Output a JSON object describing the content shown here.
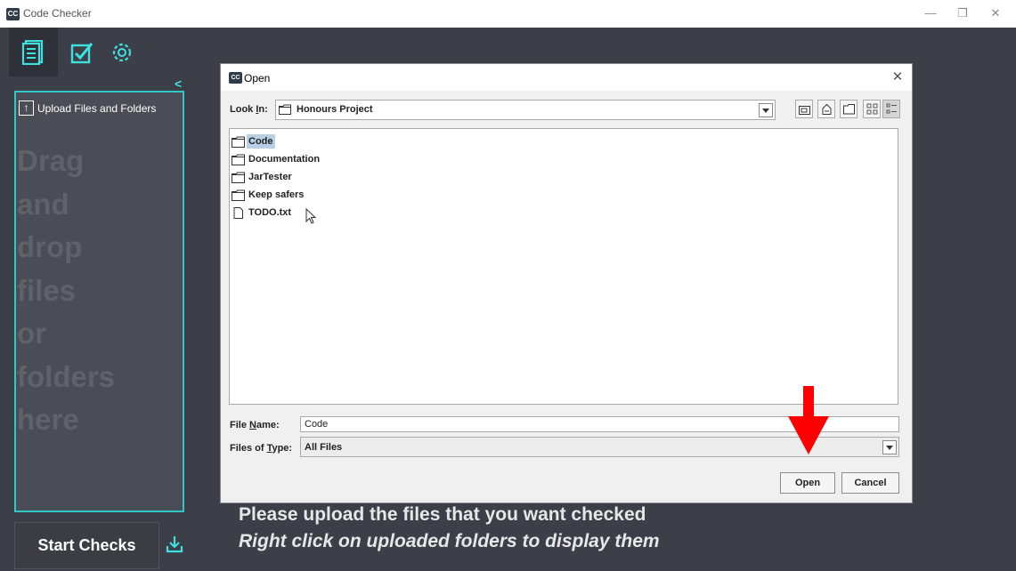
{
  "window": {
    "title": "Code Checker",
    "app_icon_text": "CC"
  },
  "sidebar": {
    "collapse_symbol": "<",
    "upload_label": "Upload Files and Folders",
    "drag_lines": [
      "Drag",
      "and",
      "drop",
      "files",
      "or",
      "folders",
      "here"
    ],
    "start_button": "Start Checks",
    "icons": [
      "document-icon",
      "checkbox-icon",
      "gear-icon",
      "download-icon"
    ]
  },
  "main": {
    "hint_line1": "Please upload the files that you want checked",
    "hint_line2": "Right click on uploaded folders to display them"
  },
  "dialog": {
    "title": "Open",
    "look_in_label": "Look In:",
    "look_in_value": "Honours Project",
    "files": [
      {
        "name": "Code",
        "type": "folder",
        "selected": true
      },
      {
        "name": "Documentation",
        "type": "folder",
        "selected": false
      },
      {
        "name": "JarTester",
        "type": "folder",
        "selected": false
      },
      {
        "name": "Keep safers",
        "type": "folder",
        "selected": false
      },
      {
        "name": "TODO.txt",
        "type": "file",
        "selected": false
      }
    ],
    "file_name_label": "File Name:",
    "file_name_value": "Code",
    "files_of_type_label": "Files of Type:",
    "files_of_type_value": "All Files",
    "open_button": "Open",
    "cancel_button": "Cancel"
  },
  "colors": {
    "accent": "#2ec9c4",
    "background": "#3c3f47",
    "annotation_arrow": "#ff0000"
  }
}
